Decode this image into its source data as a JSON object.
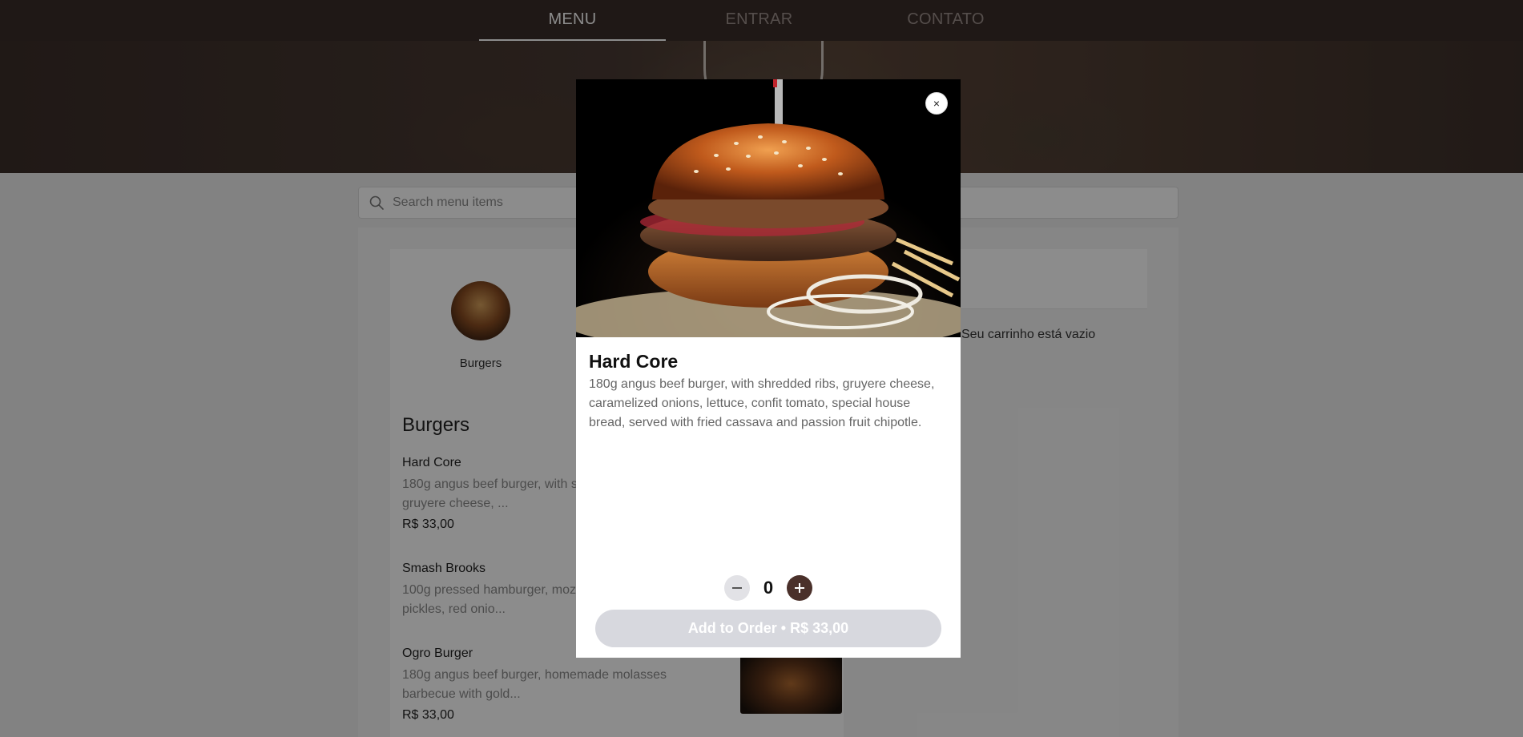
{
  "nav": {
    "tabs": [
      {
        "label": "MENU",
        "active": true
      },
      {
        "label": "ENTRAR",
        "active": false
      },
      {
        "label": "CONTATO",
        "active": false
      }
    ]
  },
  "search": {
    "placeholder": "Search menu items",
    "value": ""
  },
  "categories": [
    {
      "label": "Burgers",
      "icon": "burger-thumbnail"
    }
  ],
  "section": {
    "title": "Burgers",
    "items": [
      {
        "name": "Hard Core",
        "desc": "180g angus beef burger, with shredded ribs, gruyere cheese, ...",
        "price": "R$ 33,00"
      },
      {
        "name": "Smash Brooks",
        "desc": "100g pressed hamburger, mozzarella cheese, pickles, red onio...",
        "price": ""
      },
      {
        "name": "Ogro Burger",
        "desc": "180g angus beef burger, homemade molasses barbecue with gold...",
        "price": "R$ 33,00"
      }
    ]
  },
  "cart": {
    "empty_text": "Seu carrinho está vazio",
    "visible_text": "stá vazio"
  },
  "modal": {
    "title": "Hard Core",
    "description": "180g angus beef burger, with shredded ribs, gruyere cheese, caramelized onions, lettuce, confit tomato, special house bread, served with fried cassava and passion fruit chipotle.",
    "quantity": "0",
    "close_label": "×",
    "add_button_label": "Add to Order • R$ 33,00"
  },
  "colors": {
    "nav_bg": "#3a2c28",
    "accent": "#4a302a",
    "button_disabled": "#d7d8de",
    "overlay": "rgba(0,0,0,0.45)"
  }
}
